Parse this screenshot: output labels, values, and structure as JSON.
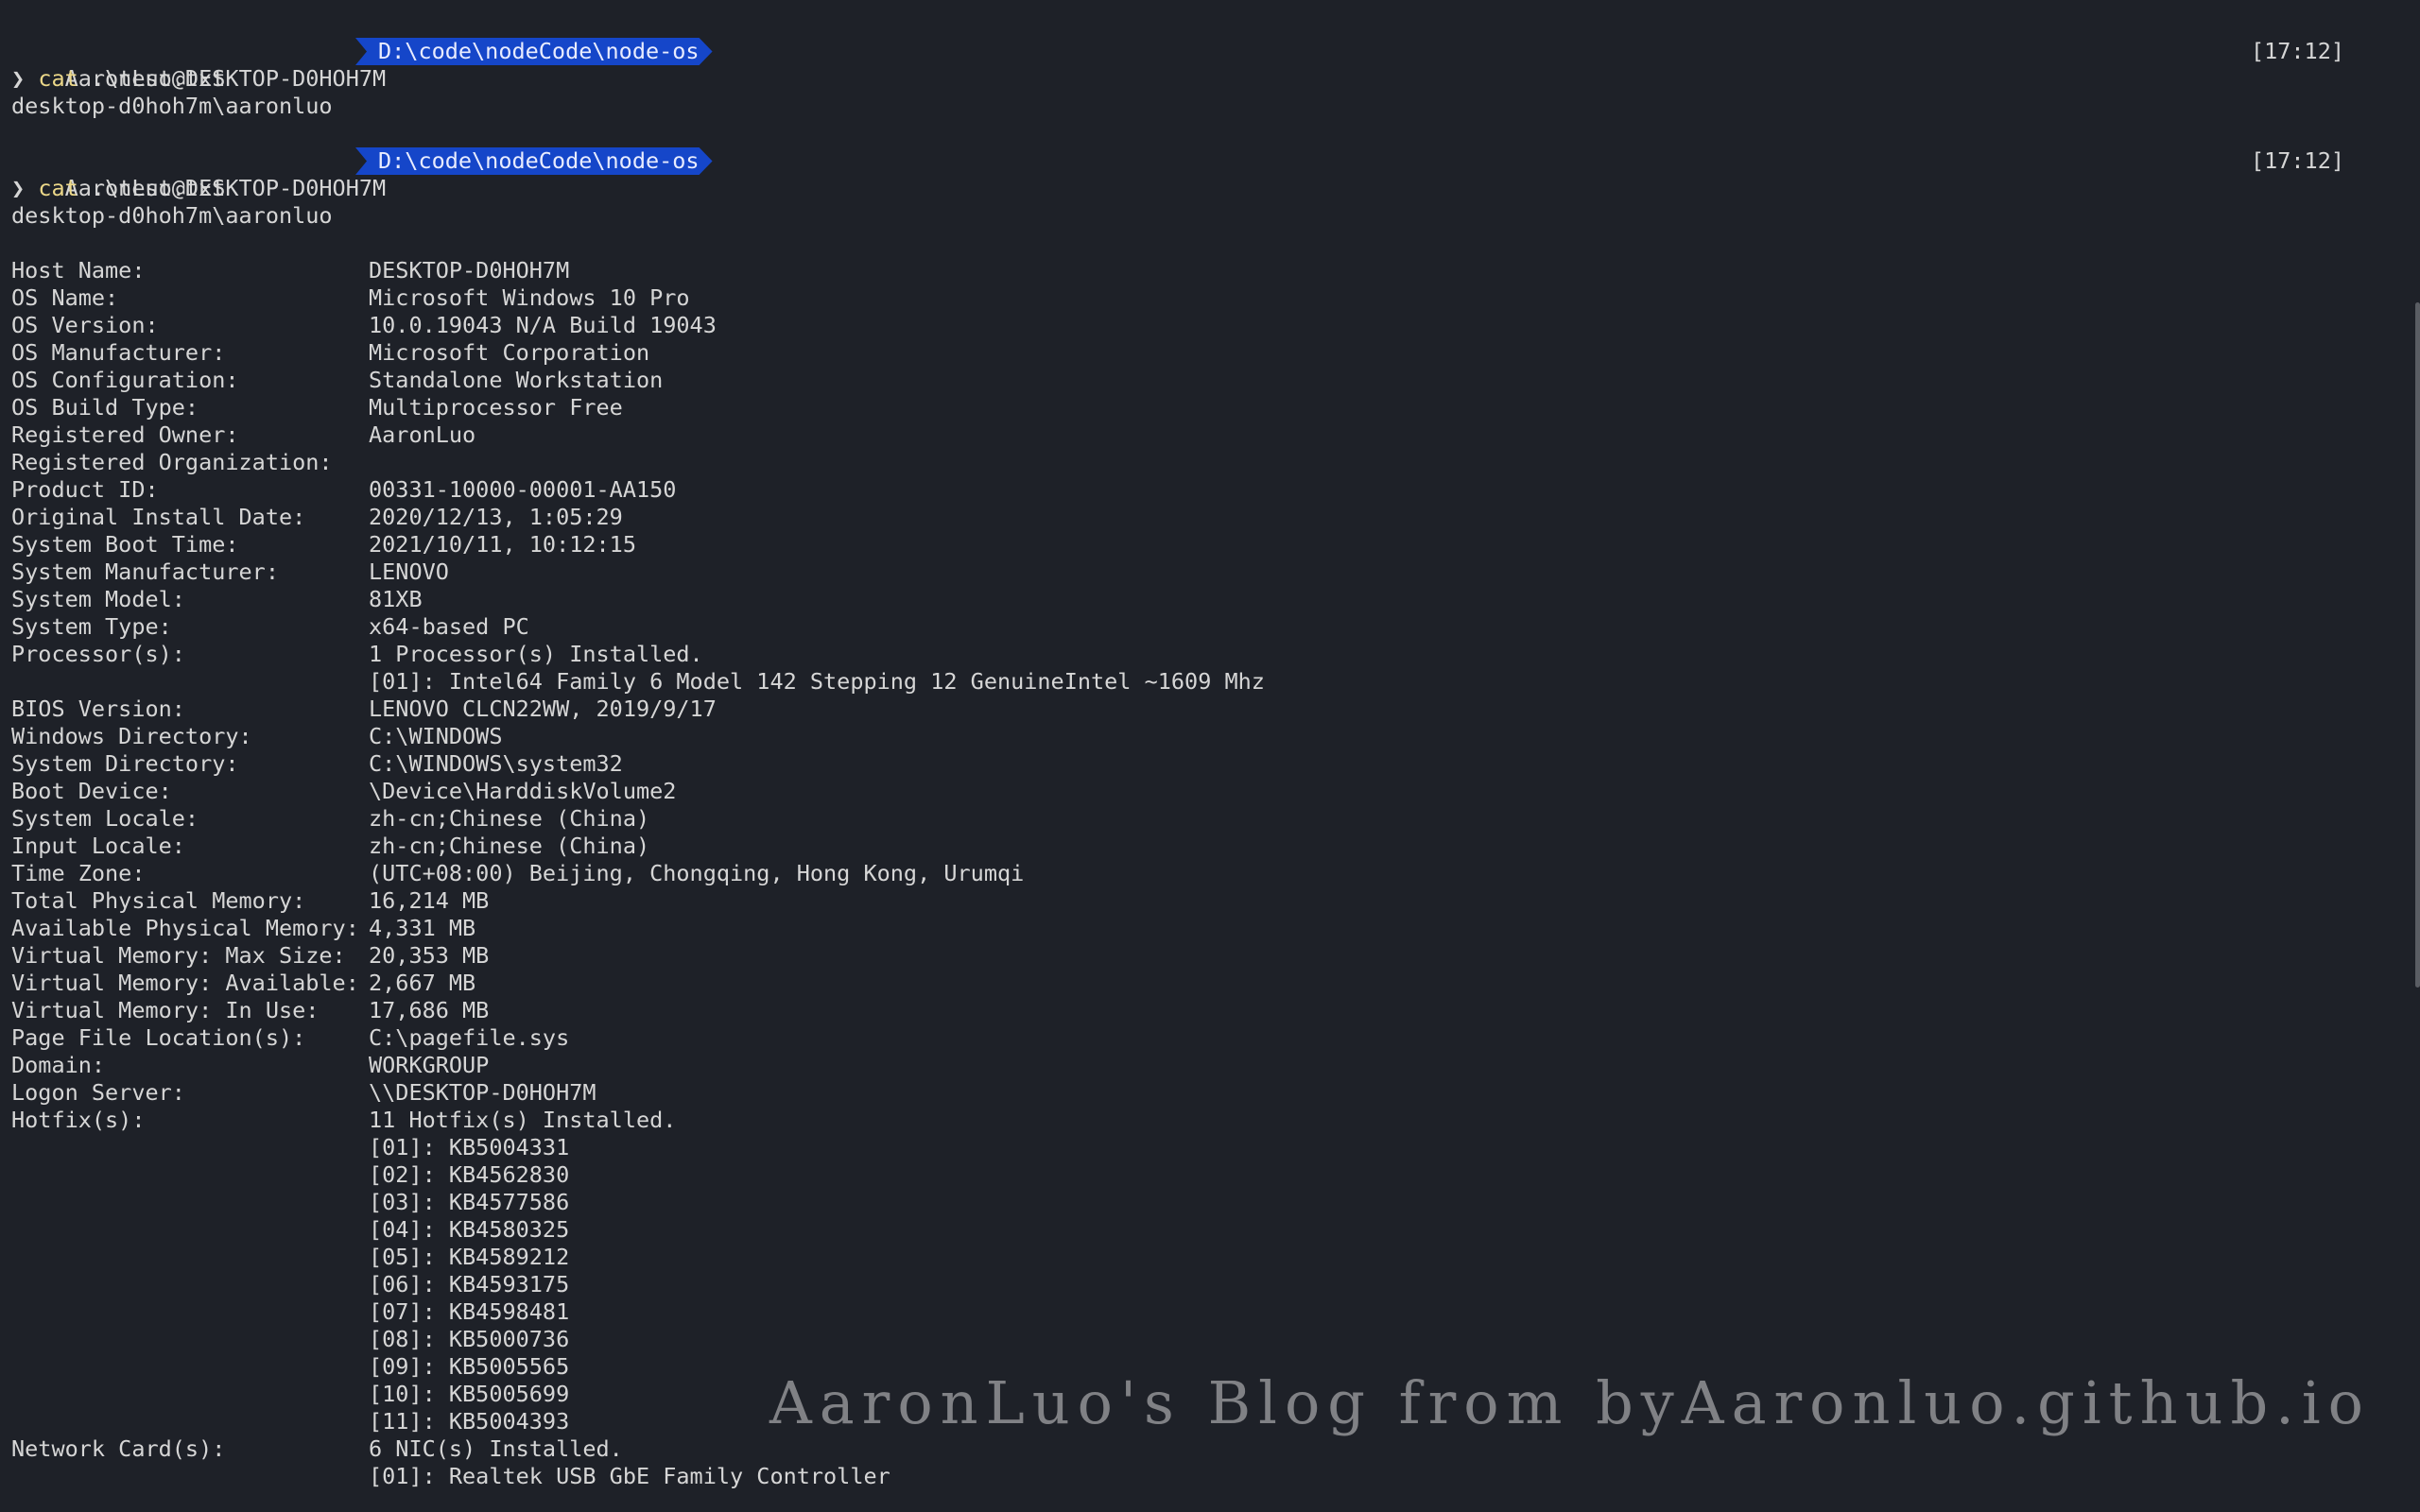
{
  "prompts": [
    {
      "user": "AaronLuo@DESKTOP-D0HOH7M",
      "path": "D:\\code\\nodeCode\\node-os",
      "time": "[17:12]",
      "chevron": "❯",
      "command": "cat",
      "argument": ".\\test.txt",
      "output": "desktop-d0hoh7m\\aaronluo"
    },
    {
      "user": "AaronLuo@DESKTOP-D0HOH7M",
      "path": "D:\\code\\nodeCode\\node-os",
      "time": "[17:12]",
      "chevron": "❯",
      "command": "cat",
      "argument": ".\\test.txt",
      "output": "desktop-d0hoh7m\\aaronluo"
    }
  ],
  "sysinfo": [
    {
      "label": "Host Name:",
      "value": "DESKTOP-D0HOH7M"
    },
    {
      "label": "OS Name:",
      "value": "Microsoft Windows 10 Pro"
    },
    {
      "label": "OS Version:",
      "value": "10.0.19043 N/A Build 19043"
    },
    {
      "label": "OS Manufacturer:",
      "value": "Microsoft Corporation"
    },
    {
      "label": "OS Configuration:",
      "value": "Standalone Workstation"
    },
    {
      "label": "OS Build Type:",
      "value": "Multiprocessor Free"
    },
    {
      "label": "Registered Owner:",
      "value": "AaronLuo"
    },
    {
      "label": "Registered Organization:",
      "value": ""
    },
    {
      "label": "Product ID:",
      "value": "00331-10000-00001-AA150"
    },
    {
      "label": "Original Install Date:",
      "value": "2020/12/13, 1:05:29"
    },
    {
      "label": "System Boot Time:",
      "value": "2021/10/11, 10:12:15"
    },
    {
      "label": "System Manufacturer:",
      "value": "LENOVO"
    },
    {
      "label": "System Model:",
      "value": "81XB"
    },
    {
      "label": "System Type:",
      "value": "x64-based PC"
    },
    {
      "label": "Processor(s):",
      "value": "1 Processor(s) Installed."
    },
    {
      "label": "",
      "value": "[01]: Intel64 Family 6 Model 142 Stepping 12 GenuineIntel ~1609 Mhz"
    },
    {
      "label": "BIOS Version:",
      "value": "LENOVO CLCN22WW, 2019/9/17"
    },
    {
      "label": "Windows Directory:",
      "value": "C:\\WINDOWS"
    },
    {
      "label": "System Directory:",
      "value": "C:\\WINDOWS\\system32"
    },
    {
      "label": "Boot Device:",
      "value": "\\Device\\HarddiskVolume2"
    },
    {
      "label": "System Locale:",
      "value": "zh-cn;Chinese (China)"
    },
    {
      "label": "Input Locale:",
      "value": "zh-cn;Chinese (China)"
    },
    {
      "label": "Time Zone:",
      "value": "(UTC+08:00) Beijing, Chongqing, Hong Kong, Urumqi"
    },
    {
      "label": "Total Physical Memory:",
      "value": "16,214 MB"
    },
    {
      "label": "Available Physical Memory:",
      "value": "4,331 MB"
    },
    {
      "label": "Virtual Memory: Max Size:",
      "value": "20,353 MB"
    },
    {
      "label": "Virtual Memory: Available:",
      "value": "2,667 MB"
    },
    {
      "label": "Virtual Memory: In Use:",
      "value": "17,686 MB"
    },
    {
      "label": "Page File Location(s):",
      "value": "C:\\pagefile.sys"
    },
    {
      "label": "Domain:",
      "value": "WORKGROUP"
    },
    {
      "label": "Logon Server:",
      "value": "\\\\DESKTOP-D0HOH7M"
    },
    {
      "label": "Hotfix(s):",
      "value": "11 Hotfix(s) Installed."
    },
    {
      "label": "",
      "value": "[01]: KB5004331"
    },
    {
      "label": "",
      "value": "[02]: KB4562830"
    },
    {
      "label": "",
      "value": "[03]: KB4577586"
    },
    {
      "label": "",
      "value": "[04]: KB4580325"
    },
    {
      "label": "",
      "value": "[05]: KB4589212"
    },
    {
      "label": "",
      "value": "[06]: KB4593175"
    },
    {
      "label": "",
      "value": "[07]: KB4598481"
    },
    {
      "label": "",
      "value": "[08]: KB5000736"
    },
    {
      "label": "",
      "value": "[09]: KB5005565"
    },
    {
      "label": "",
      "value": "[10]: KB5005699"
    },
    {
      "label": "",
      "value": "[11]: KB5004393"
    },
    {
      "label": "Network Card(s):",
      "value": "6 NIC(s) Installed."
    },
    {
      "label": "",
      "value": "[01]: Realtek USB GbE Family Controller"
    }
  ],
  "watermark": "AaronLuo's Blog from byAaronluo.github.io",
  "colors": {
    "background": "#1e2128",
    "path_segment": "#1546c9",
    "command": "#ecd889",
    "text": "#d6d6d6"
  }
}
